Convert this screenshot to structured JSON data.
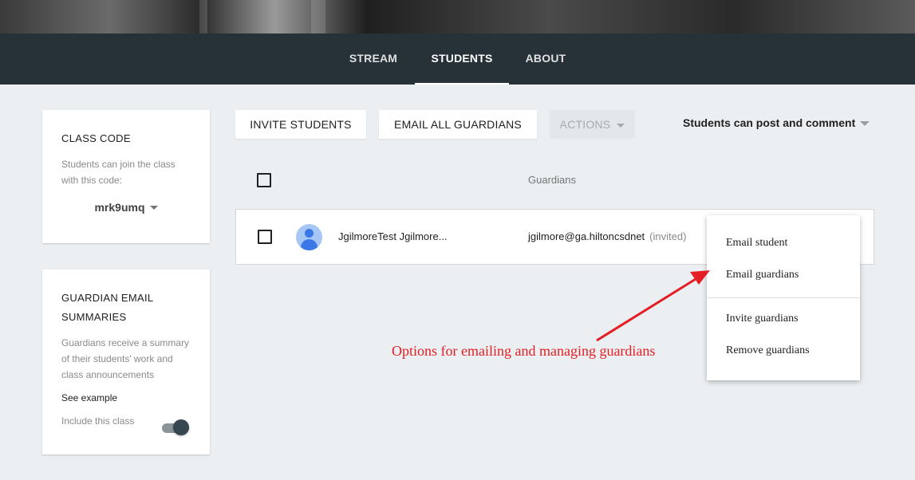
{
  "nav": {
    "tabs": [
      {
        "label": "STREAM"
      },
      {
        "label": "STUDENTS"
      },
      {
        "label": "ABOUT"
      }
    ]
  },
  "class_code_card": {
    "title": "CLASS CODE",
    "description": "Students can join the class with this code:",
    "code": "mrk9umq"
  },
  "guardian_card": {
    "title": "GUARDIAN EMAIL SUMMARIES",
    "description": "Guardians receive a summary of their students' work and class announcements",
    "see_example": "See example",
    "include_label": "Include this class",
    "include_enabled": true
  },
  "toolbar": {
    "invite_students": "INVITE STUDENTS",
    "email_all_guardians": "EMAIL ALL GUARDIANS",
    "actions": "ACTIONS",
    "permission": "Students can post and comment"
  },
  "table": {
    "guardians_header": "Guardians",
    "rows": [
      {
        "name": "JgilmoreTest Jgilmore...",
        "guardian_email": "jgilmore@ga.hiltoncsdnet",
        "guardian_status": "(invited)"
      }
    ]
  },
  "menu": {
    "items": [
      {
        "label": "Email student"
      },
      {
        "label": "Email guardians"
      },
      {
        "label": "Invite guardians"
      },
      {
        "label": "Remove guardians"
      }
    ]
  },
  "annotation": {
    "text": "Options for emailing and managing guardians",
    "color": "#e31e24"
  },
  "colors": {
    "nav_bg": "#263238",
    "page_bg": "#eceff1",
    "avatar_blue": "#3b78e7"
  }
}
